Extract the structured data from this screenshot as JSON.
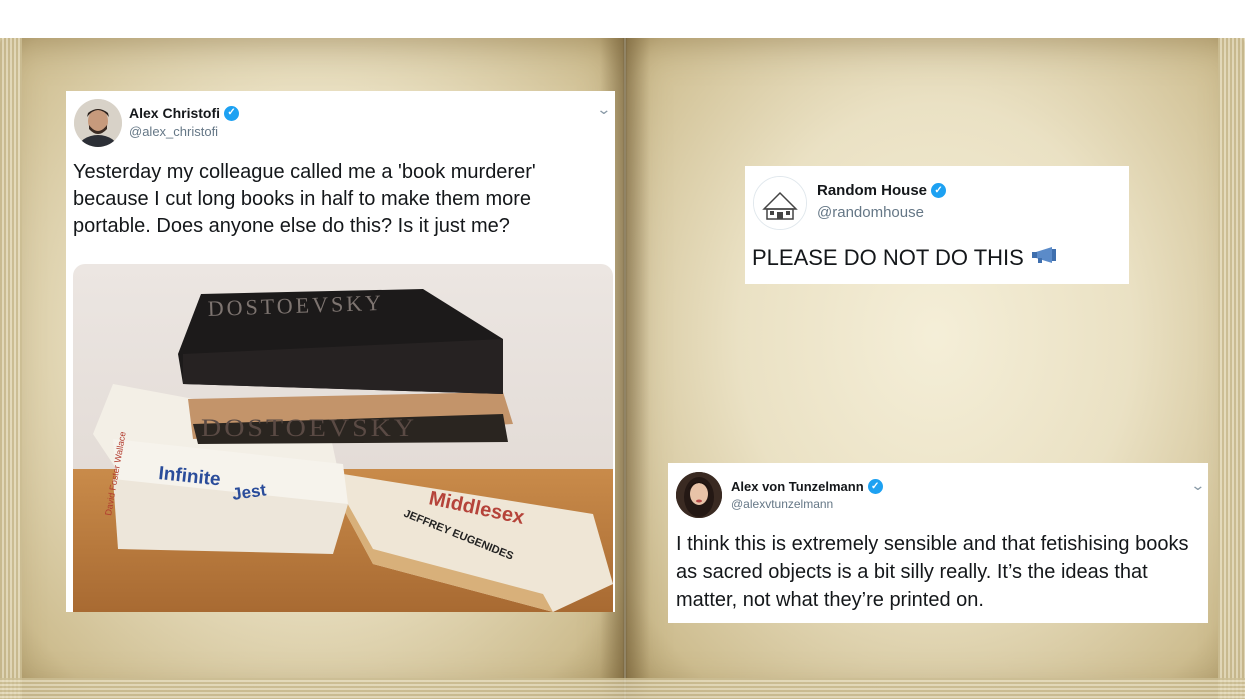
{
  "tweets": [
    {
      "name": "Alex Christofi",
      "handle": "@alex_christofi",
      "text": "Yesterday my colleague called me a 'book murderer' because I cut long books in half to make them more portable. Does anyone else do this? Is it just me?",
      "photo": {
        "spine_top": "DOSTOEVSKY",
        "spine_bottom": "DOSTOEVSKY",
        "book_title_1": "Infinite",
        "book_title_2": "Jest",
        "book_author_1": "David Foster Wallace",
        "book_title_3": "Middlesex",
        "book_author_3": "JEFFREY EUGENIDES"
      }
    },
    {
      "name": "Random House",
      "handle": "@randomhouse",
      "text": "PLEASE DO NOT DO THIS"
    },
    {
      "name": "Alex von Tunzelmann",
      "handle": "@alexvtunzelmann",
      "text": "I think this is extremely sensible and that fetishising books as sacred objects is a bit silly really. It’s the ideas that matter, not what they’re printed on."
    }
  ],
  "icons": {
    "verified": "verified-badge-icon",
    "menu": "chevron-down-icon",
    "megaphone": "megaphone-icon"
  },
  "colors": {
    "verified_blue": "#1da1f2",
    "handle_gray": "#657786",
    "page_parchment": "#ece3c6"
  }
}
